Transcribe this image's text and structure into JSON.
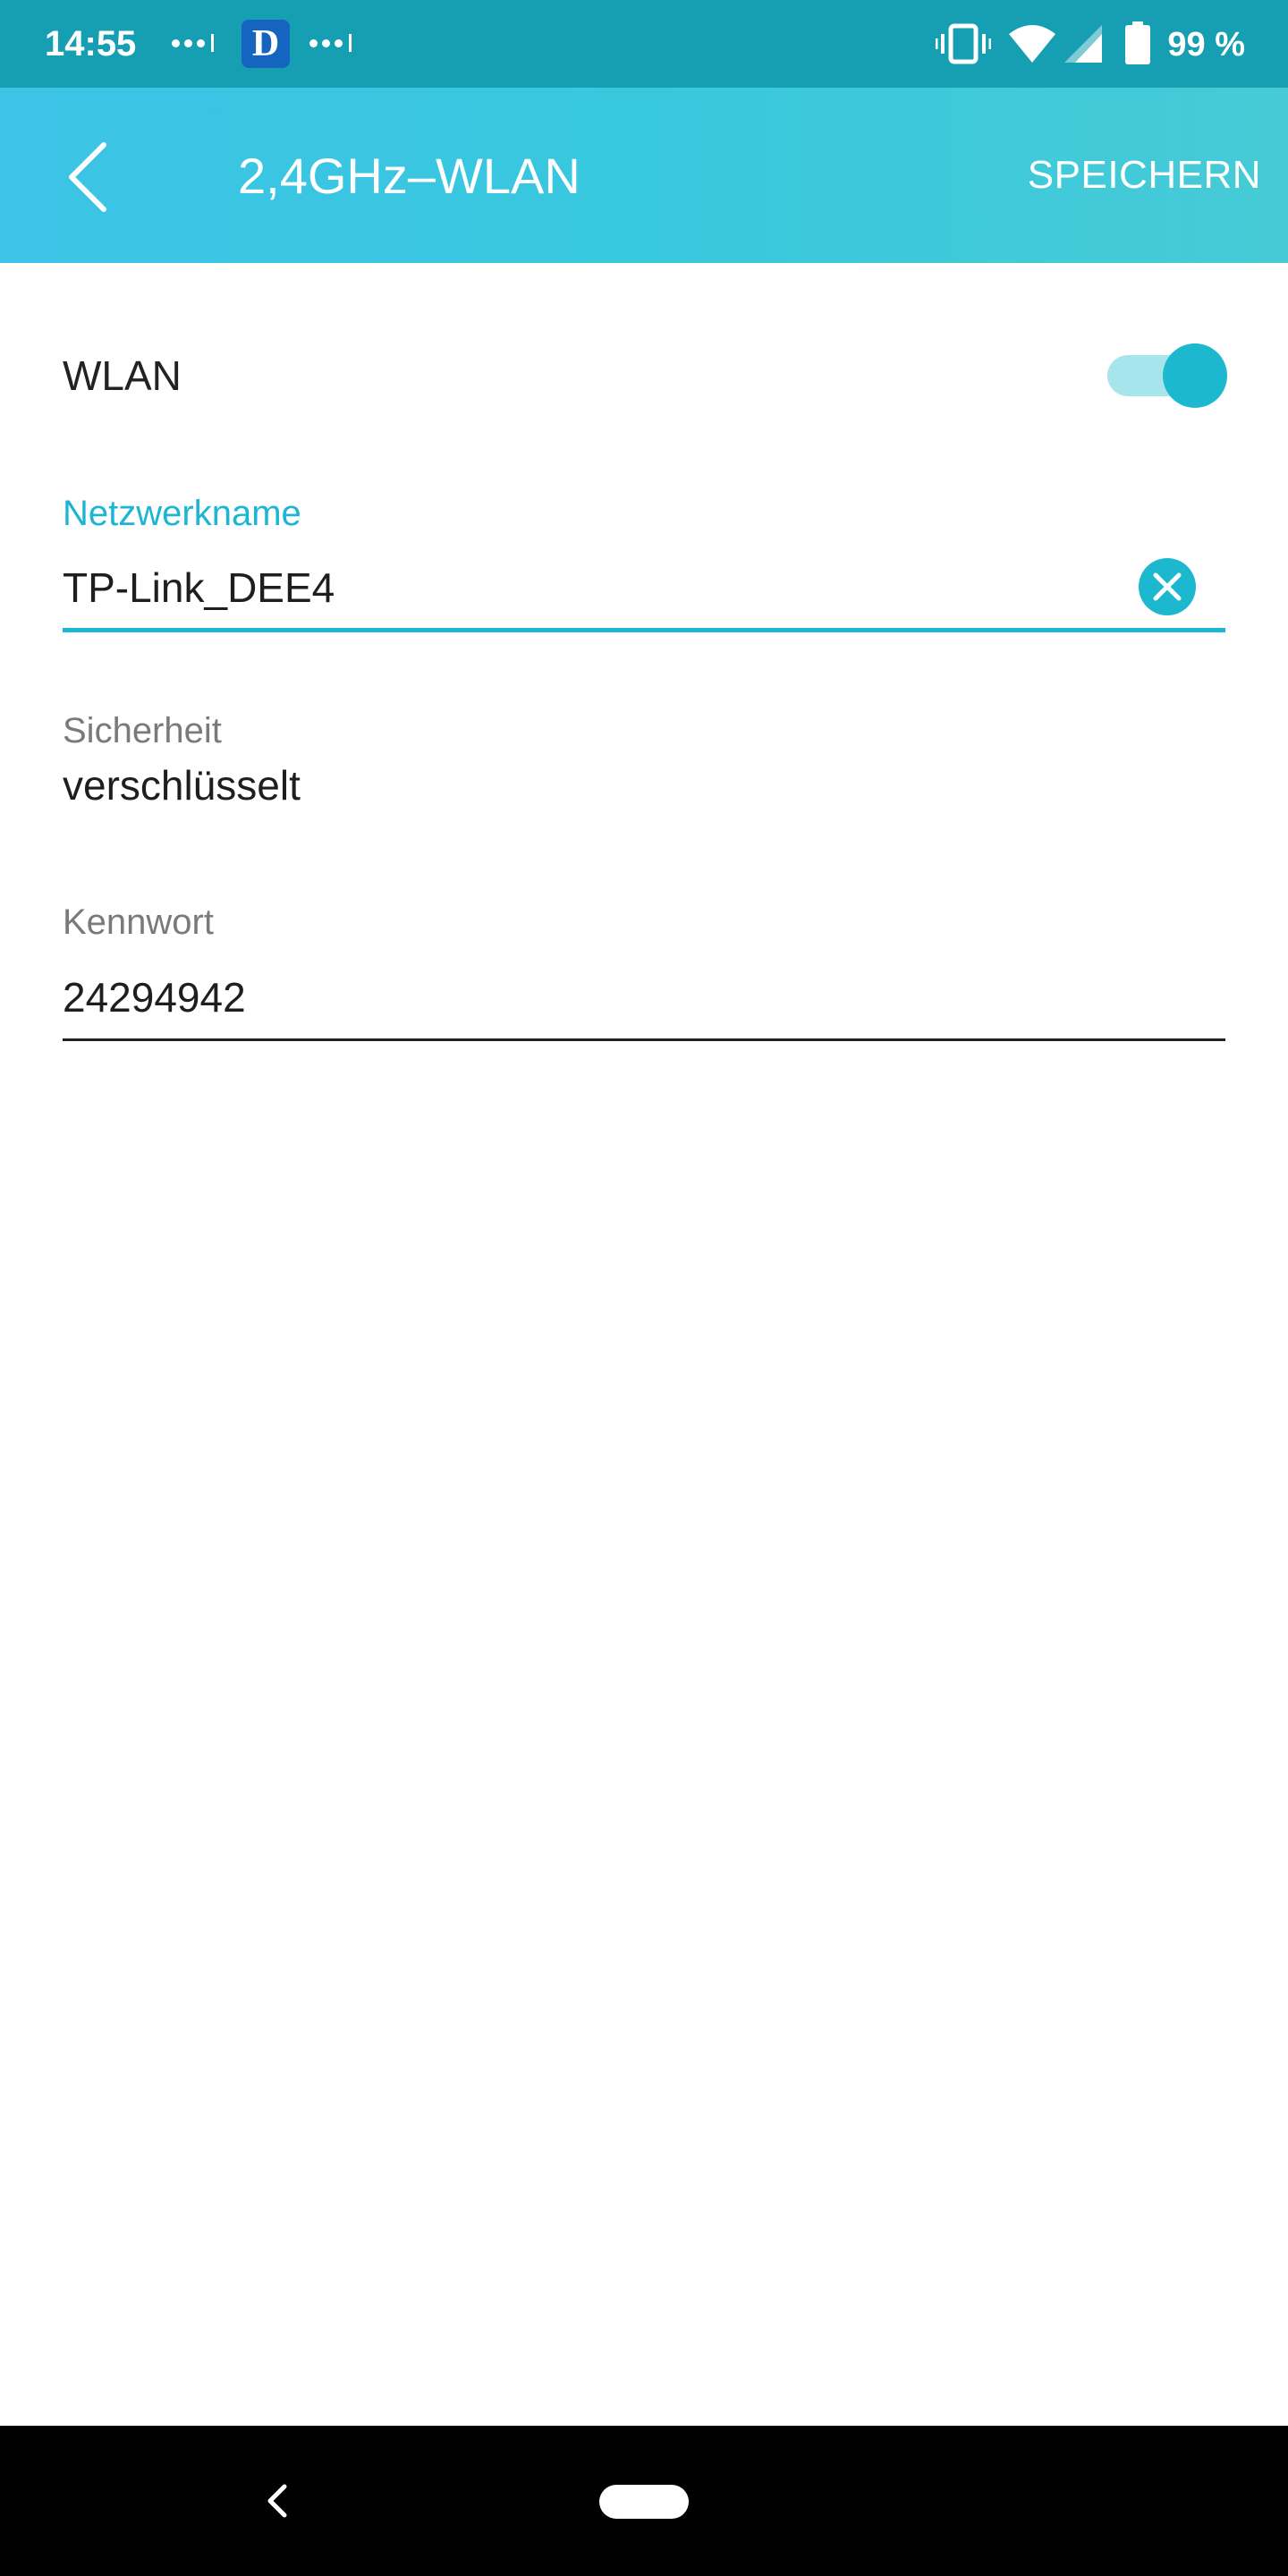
{
  "status_bar": {
    "time": "14:55",
    "battery_text": "99 %",
    "icons": [
      "signal-dots-icon",
      "app-d-icon",
      "vibrate-icon",
      "wifi-icon",
      "cell-signal-icon",
      "battery-icon"
    ],
    "app_badge_letter": "D"
  },
  "header": {
    "title": "2,4GHz–WLAN",
    "save_label": "SPEICHERN",
    "back_icon": "chevron-left-icon"
  },
  "wlan": {
    "label": "WLAN",
    "enabled": true
  },
  "network_name": {
    "label": "Netzwerkname",
    "value": "TP-Link_DEE4",
    "clear_icon": "clear-icon"
  },
  "security": {
    "label": "Sicherheit",
    "value": "verschlüsselt"
  },
  "password": {
    "label": "Kennwort",
    "value": "24294942"
  },
  "colors": {
    "status_bar": "#169eb2",
    "header_start": "#3cc3e6",
    "header_end": "#46cbd6",
    "accent": "#1cb5d3",
    "toggle_track": "#a7e5ec"
  }
}
